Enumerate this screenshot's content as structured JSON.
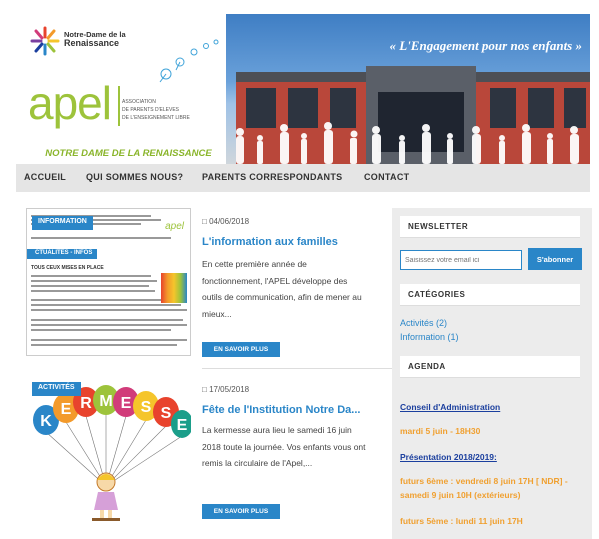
{
  "header": {
    "school_name_line1": "Notre-Dame de la",
    "school_name_line2": "Renaissance",
    "apel_word": "apel",
    "apel_sub_line1": "ASSOCIATION",
    "apel_sub_line2": "DE PARENTS D'ELEVES",
    "apel_sub_line3": "DE L'ENSEIGNEMENT LIBRE",
    "ndr_banner": "NOTRE DAME DE LA RENAISSANCE",
    "slogan": "« L'Engagement pour nos enfants »"
  },
  "nav": {
    "items": [
      {
        "label": "ACCUEIL"
      },
      {
        "label": "QUI SOMMES NOUS?"
      },
      {
        "label": "PARENTS CORRESPONDANTS"
      },
      {
        "label": "CONTACT"
      }
    ]
  },
  "posts": [
    {
      "tag": "INFORMATION",
      "date": "04/06/2018",
      "title": "L'information aux familles",
      "excerpt": "En cette première année de fonctionnement, l'APEL développe des outils de communication, afin de mener au mieux...",
      "button": "EN SAVOIR PLUS",
      "doc_tag": "CTUALITES - INFOS",
      "doc_heading": "TOUS CEUX MISES EN PLACE",
      "doc_apel": "apel"
    },
    {
      "tag": "ACTIVITÉS",
      "date": "17/05/2018",
      "title": "Fête de l'Institution Notre Da...",
      "excerpt": "La kermesse aura lieu le samedi 16 juin 2018 toute la journée. Vos enfants vous ont remis la circulaire de l'Apel,...",
      "button": "EN SAVOIR PLUS",
      "balloon_letters": [
        "K",
        "E",
        "R",
        "M",
        "E",
        "S",
        "S",
        "E"
      ]
    }
  ],
  "sidebar": {
    "newsletter": {
      "heading": "NEWSLETTER",
      "placeholder": "Saisissez votre email ici",
      "button": "S'abonner"
    },
    "categories": {
      "heading": "CATÉGORIES",
      "items": [
        {
          "label": "Activités (2)"
        },
        {
          "label": "Information (1)"
        }
      ]
    },
    "agenda": {
      "heading": "AGENDA",
      "link1": "Conseil d'Administration",
      "date1": "mardi 5 juin - 18H30",
      "link2": "Présentation 2018/2019:",
      "date2": "futurs 6ème : vendredi 8 juin 17H [ NDR] - samedi 9 juin 10H (extérieurs)",
      "date3": "futurs 5ème : lundi 11 juin 17H"
    }
  },
  "colors": {
    "accent": "#2a86c8",
    "apel_green": "#9dc33b",
    "agenda_orange": "#f0a030",
    "agenda_link": "#1b3f9e"
  }
}
